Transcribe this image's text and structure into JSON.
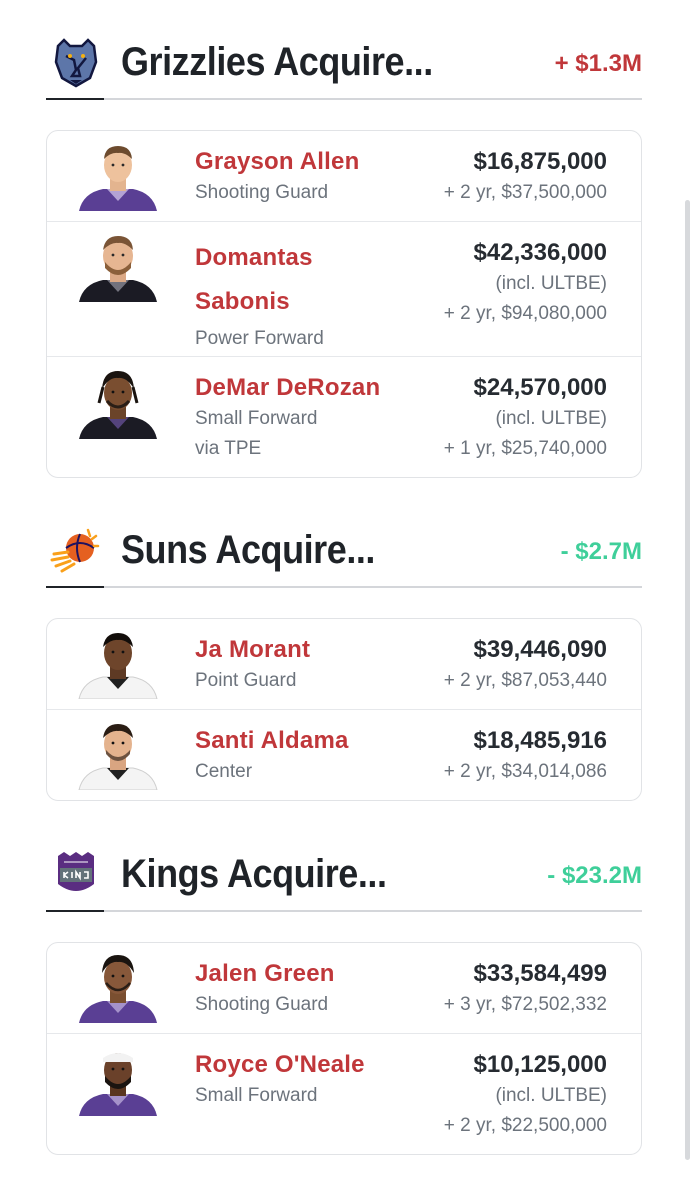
{
  "colors": {
    "player_name": "#c0373a",
    "delta_positive": "#c0373a",
    "delta_negative": "#3fcf9a",
    "text_muted": "#6c737c",
    "heading": "#1f2328"
  },
  "sections": [
    {
      "team_logo_icon": "grizzlies-logo-icon",
      "title": "Grizzlies Acquire...",
      "delta": "+ $1.3M",
      "players": [
        {
          "name": "Grayson Allen",
          "position": "Shooting Guard",
          "via": "",
          "salary": "$16,875,000",
          "ultbe": "",
          "contract": "+ 2 yr, $37,500,000",
          "jersey": "#5a3f94"
        },
        {
          "name": "Domantas Sabonis",
          "position": "Power Forward",
          "via": "",
          "salary": "$42,336,000",
          "ultbe": "(incl. ULTBE)",
          "contract": "+ 2 yr, $94,080,000",
          "jersey": "#1b1b24"
        },
        {
          "name": "DeMar DeRozan",
          "position": "Small Forward",
          "via": "via TPE",
          "salary": "$24,570,000",
          "ultbe": "(incl. ULTBE)",
          "contract": "+ 1 yr, $25,740,000",
          "jersey": "#1b1b24"
        }
      ]
    },
    {
      "team_logo_icon": "suns-logo-icon",
      "title": "Suns Acquire...",
      "delta": "- $2.7M",
      "players": [
        {
          "name": "Ja Morant",
          "position": "Point Guard",
          "via": "",
          "salary": "$39,446,090",
          "ultbe": "",
          "contract": "+ 2 yr, $87,053,440",
          "jersey": "#f4f4f4"
        },
        {
          "name": "Santi Aldama",
          "position": "Center",
          "via": "",
          "salary": "$18,485,916",
          "ultbe": "",
          "contract": "+ 2 yr, $34,014,086",
          "jersey": "#f4f4f4"
        }
      ]
    },
    {
      "team_logo_icon": "kings-logo-icon",
      "title": "Kings Acquire...",
      "delta": "- $23.2M",
      "players": [
        {
          "name": "Jalen Green",
          "position": "Shooting Guard",
          "via": "",
          "salary": "$33,584,499",
          "ultbe": "",
          "contract": "+ 3 yr, $72,502,332",
          "jersey": "#5a3f94"
        },
        {
          "name": "Royce O'Neale",
          "position": "Small Forward",
          "via": "",
          "salary": "$10,125,000",
          "ultbe": "(incl. ULTBE)",
          "contract": "+ 2 yr, $22,500,000",
          "jersey": "#5a3f94"
        }
      ]
    }
  ]
}
